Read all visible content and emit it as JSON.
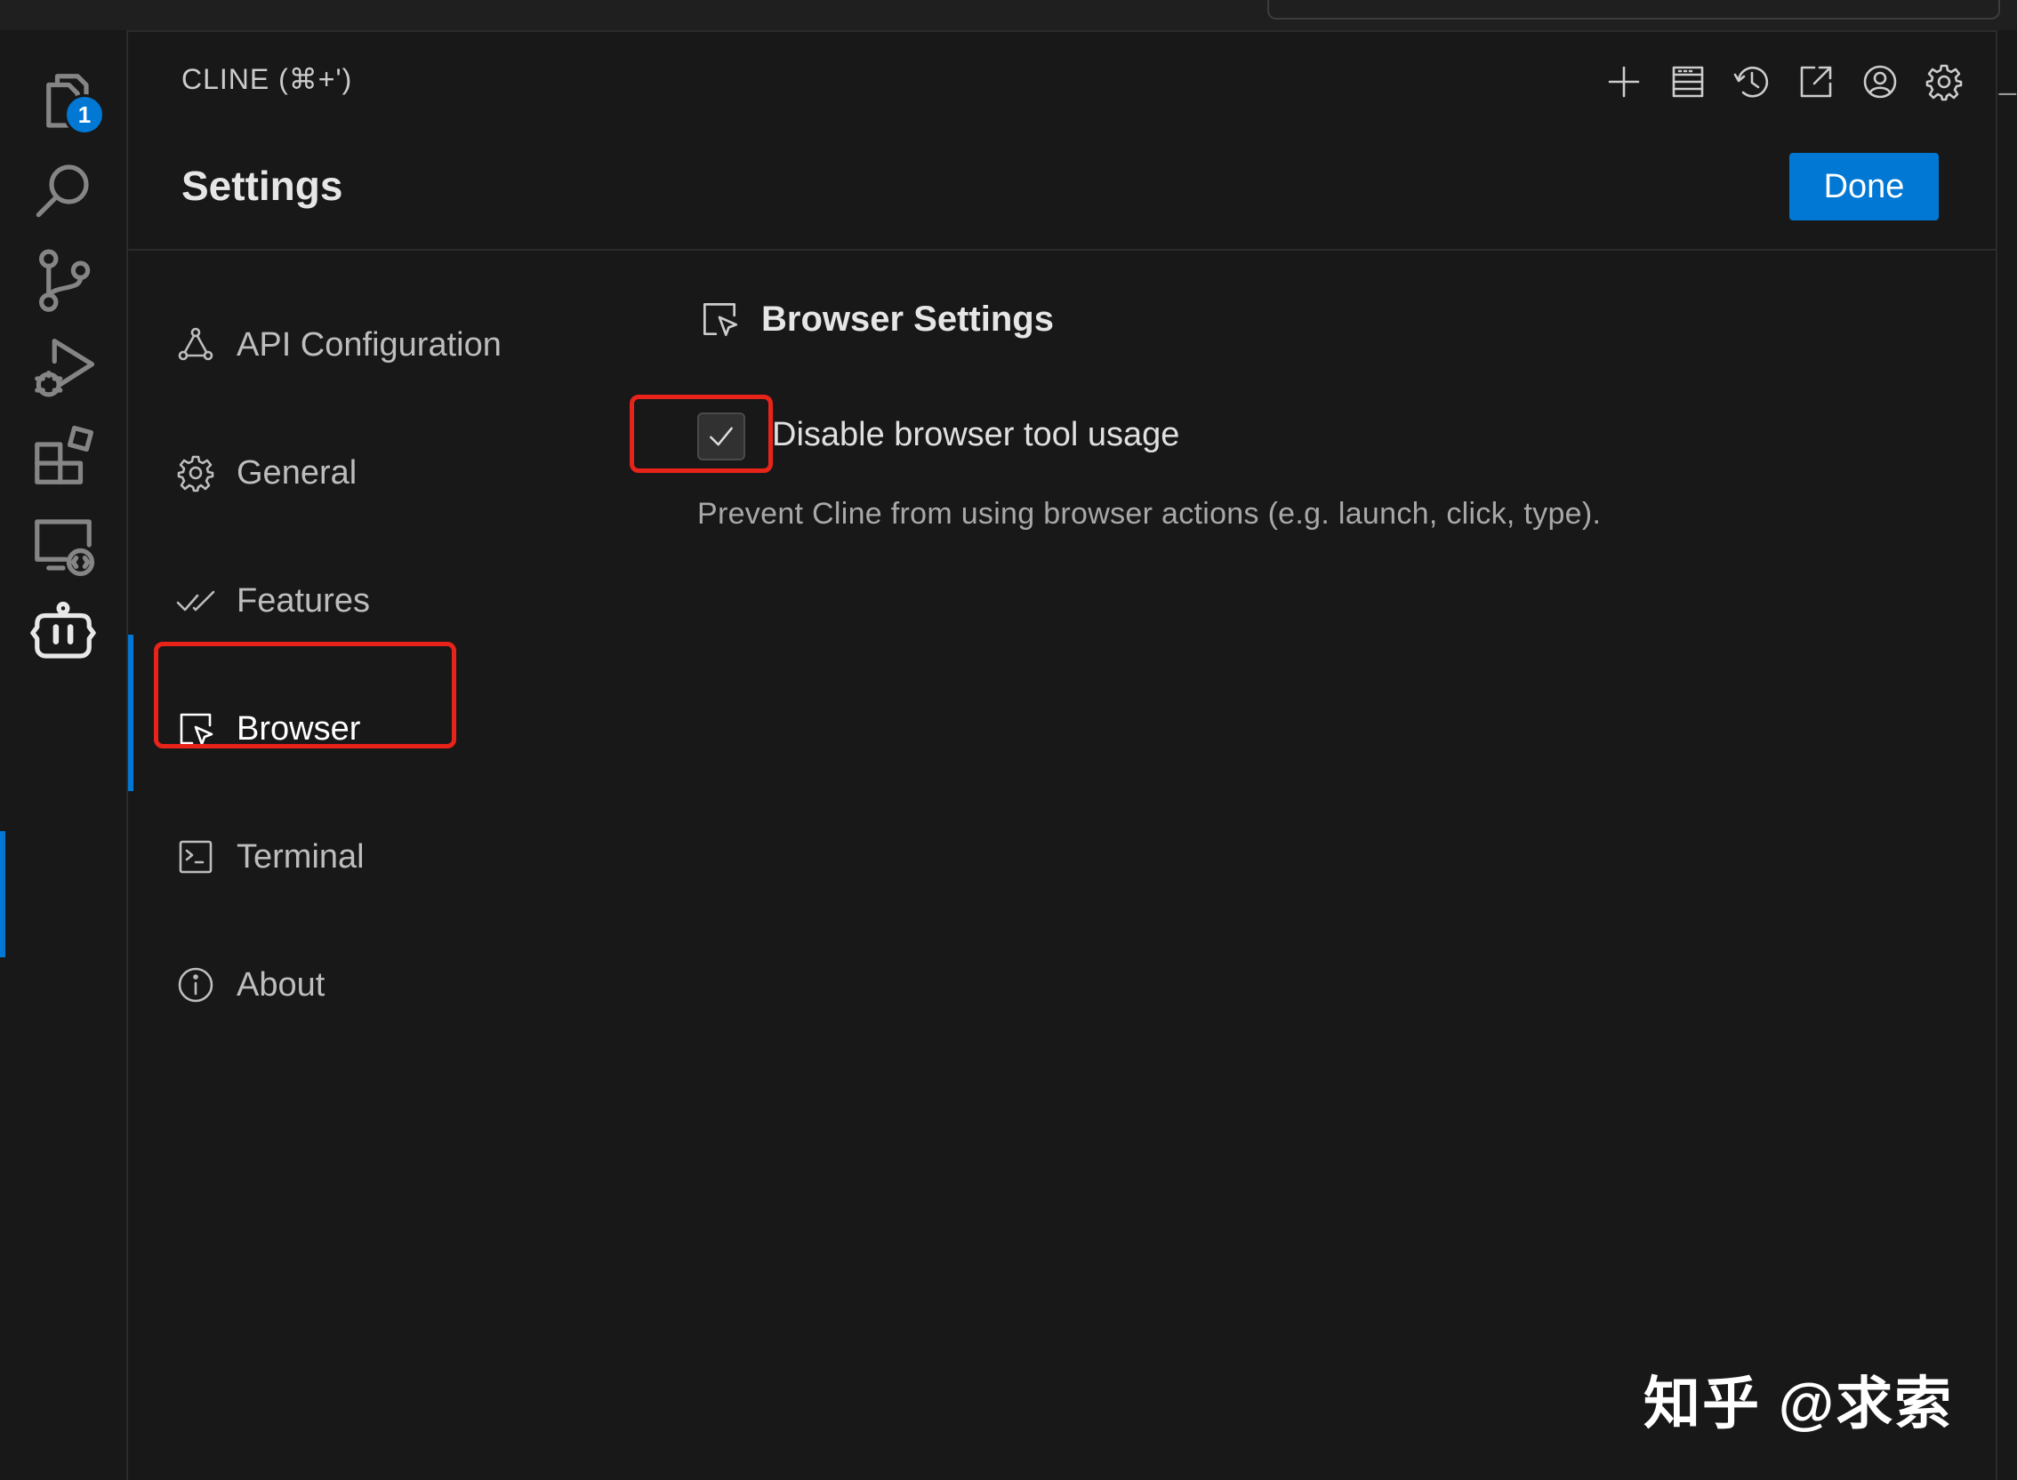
{
  "panel": {
    "title": "CLINE (⌘+')",
    "toolbar_icons": [
      "plus-icon",
      "mcp-servers-icon",
      "history-icon",
      "popout-icon",
      "account-icon",
      "settings-gear-icon"
    ]
  },
  "explorer_badge": "1",
  "settings": {
    "title": "Settings",
    "done_label": "Done"
  },
  "nav": {
    "items": [
      {
        "label": "API Configuration",
        "icon": "api-icon"
      },
      {
        "label": "General",
        "icon": "gear-icon"
      },
      {
        "label": "Features",
        "icon": "check-check-icon"
      },
      {
        "label": "Browser",
        "icon": "browser-icon",
        "active": true
      },
      {
        "label": "Terminal",
        "icon": "terminal-icon"
      },
      {
        "label": "About",
        "icon": "info-icon"
      }
    ]
  },
  "browser_settings": {
    "heading": "Browser Settings",
    "checkbox_label": "Disable browser tool usage",
    "checkbox_checked": true,
    "description": "Prevent Cline from using browser actions (e.g. launch, click, type)."
  },
  "edge_mark": "_i",
  "watermark": "知乎 @求索",
  "colors": {
    "background": "#181818",
    "accent": "#0078d4",
    "highlight": "#e8231a"
  }
}
